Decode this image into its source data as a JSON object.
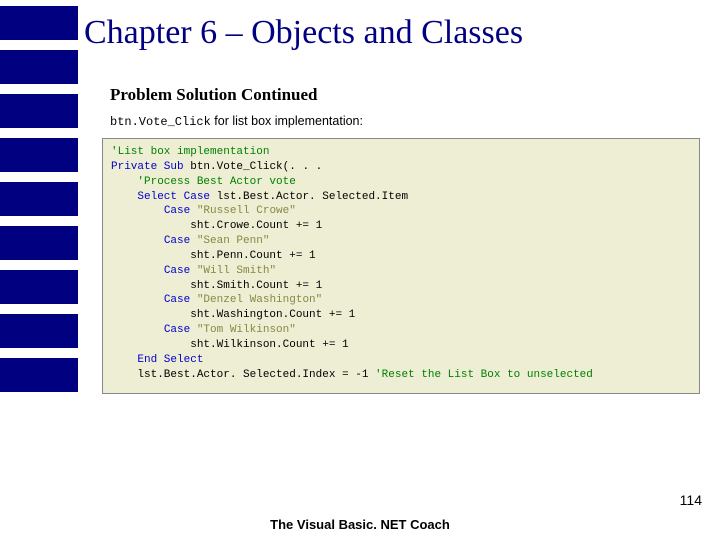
{
  "title": "Chapter 6 – Objects and Classes",
  "subtitle": "Problem Solution Continued",
  "desc_mono": "btn.Vote_Click",
  "desc_rest": " for list box implementation:",
  "code": {
    "c0": "'List box implementation",
    "l1a": "Private Sub",
    "l1b": " btn.Vote_Click(. . .",
    "c2": "'Process Best Actor vote",
    "l3a": "Select Case",
    "l3b": " lst.Best.Actor. Selected.Item",
    "l4a": "Case ",
    "s4": "\"Russell Crowe\"",
    "l5": "sht.Crowe.Count += 1",
    "l6a": "Case ",
    "s6": "\"Sean Penn\"",
    "l7": "sht.Penn.Count += 1",
    "l8a": "Case ",
    "s8": "\"Will Smith\"",
    "l9": "sht.Smith.Count += 1",
    "l10a": "Case ",
    "s10": "\"Denzel Washington\"",
    "l11": "sht.Washington.Count += 1",
    "l12a": "Case ",
    "s12": "\"Tom Wilkinson\"",
    "l13": "sht.Wilkinson.Count += 1",
    "l14": "End Select",
    "l15a": "lst.Best.Actor. Selected.Index = -1 ",
    "c15": "'Reset the List Box to unselected"
  },
  "footer": "The Visual Basic. NET Coach",
  "pagenum": "114"
}
